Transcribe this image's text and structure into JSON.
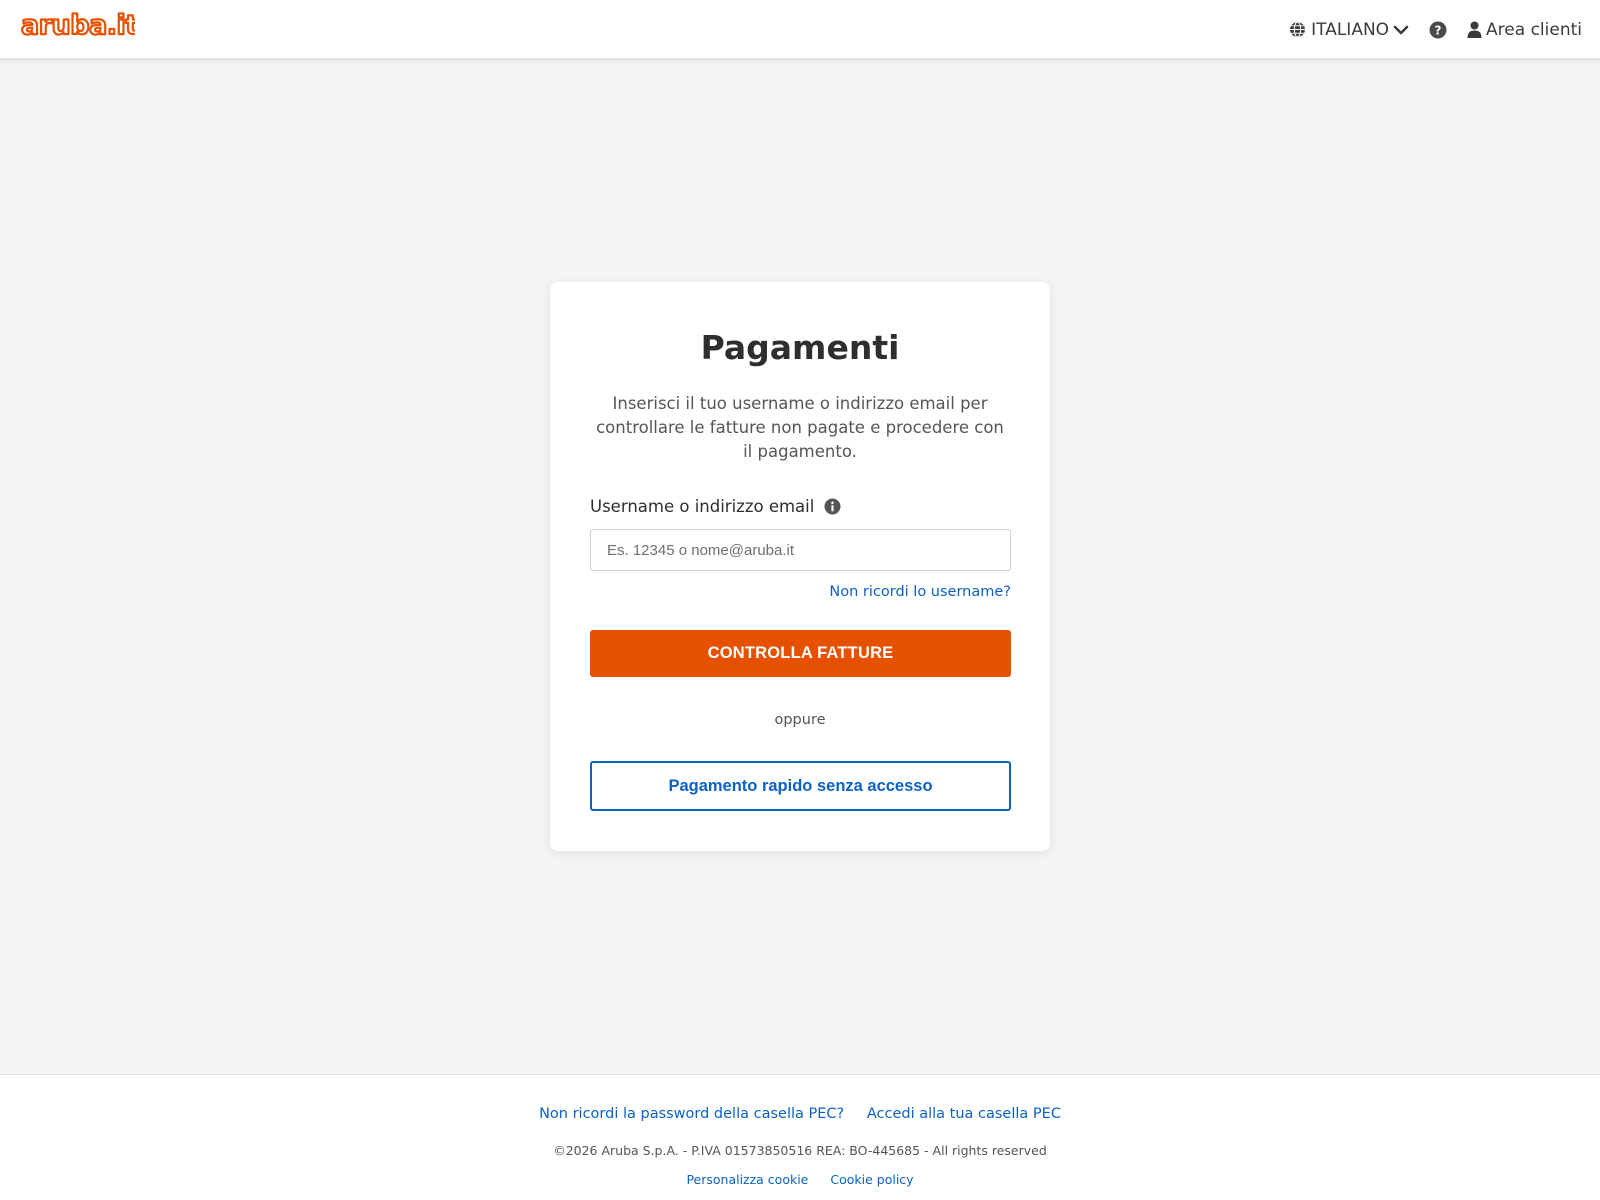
{
  "brand": {
    "logo_text": "aruba.it",
    "accent_color": "#e65100",
    "link_color": "#0b62c4"
  },
  "header": {
    "language_label": "ITALIANO",
    "account_label": "Area clienti",
    "icons": [
      "globe-icon",
      "chevron-down-icon",
      "help-icon",
      "user-icon"
    ]
  },
  "card": {
    "title": "Pagamenti",
    "description": "Inserisci il tuo username o indirizzo email per controllare le fatture non pagate e procedere con il pagamento.",
    "field_label": "Username o indirizzo email",
    "input_placeholder": "Es. 12345 o nome@aruba.it",
    "input_value": "",
    "forgot_link": "Non ricordi lo username?",
    "primary_button": "CONTROLLA FATTURE",
    "separator": "oppure",
    "secondary_button": "Pagamento rapido senza accesso"
  },
  "footer": {
    "link_pec_password": "Non ricordi la password della casella PEC?",
    "link_pec_access": "Accedi alla tua casella PEC",
    "copyright": "©2026 Aruba S.p.A. - P.IVA 01573850516 REA: BO-445685 - All rights reserved",
    "link_cookie_customize": "Personalizza cookie",
    "link_cookie_policy": "Cookie policy"
  }
}
